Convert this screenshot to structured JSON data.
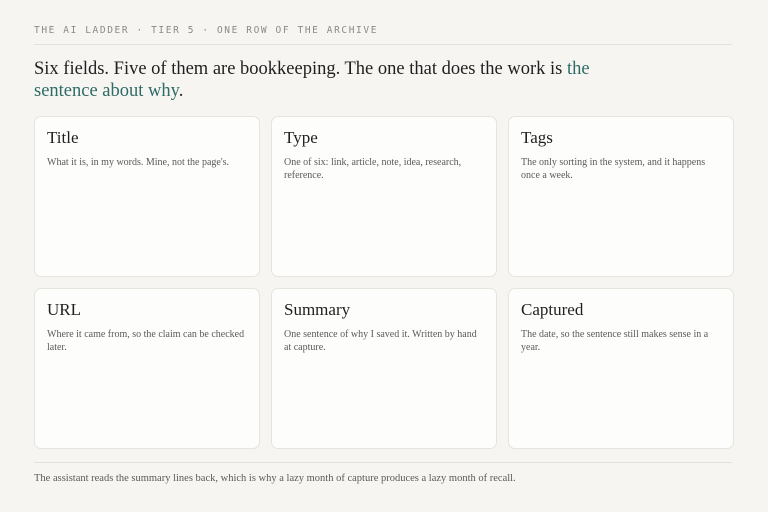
{
  "eyebrow": "THE AI LADDER · TIER 5 · ONE ROW OF THE ARCHIVE",
  "headline": {
    "lead": "Six fields. Five of them are bookkeeping. The one that does the work is ",
    "accent": "the sentence about why",
    "tail": "."
  },
  "cards": [
    {
      "title": "Title",
      "description": "What it is, in my words. Mine, not the page's."
    },
    {
      "title": "Type",
      "description": "One of six: link, article, note, idea, research, reference."
    },
    {
      "title": "Tags",
      "description": "The only sorting in the system, and it happens once a week."
    },
    {
      "title": "URL",
      "description": "Where it came from, so the claim can be checked later."
    },
    {
      "title": "Summary",
      "description": "One sentence of why I saved it. Written by hand at capture."
    },
    {
      "title": "Captured",
      "description": "The date, so the sentence still makes sense in a year."
    }
  ],
  "footer": "The assistant reads the summary lines back, which is why a lazy month of capture produces a lazy month of recall.",
  "colors": {
    "background": "#f6f5f1",
    "accent": "#2f6b66",
    "card": "#fdfdfb"
  }
}
